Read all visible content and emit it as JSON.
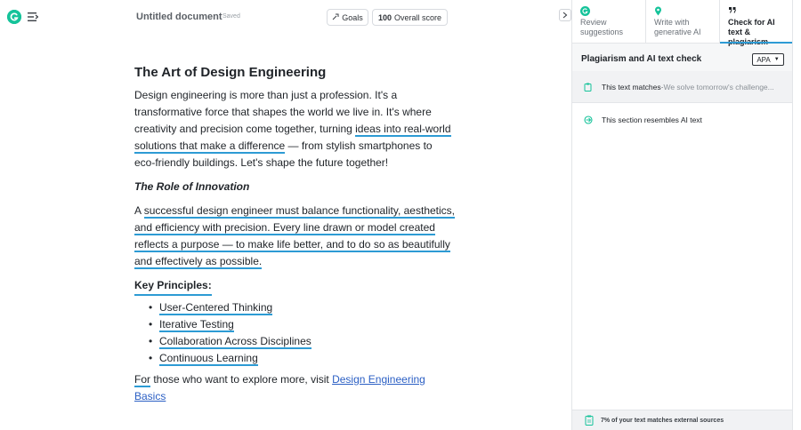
{
  "app": {
    "doc_title": "Untitled document",
    "save_status": "Saved",
    "goals_label": "Goals",
    "score_value": "100",
    "score_label": "Overall score",
    "accent_color": "#15c39a",
    "underline_color": "#2d9bd4"
  },
  "document": {
    "title": "The Art of Design Engineering",
    "intro_before": "Design engineering is more than just a profession. It's a transformative force that shapes the world we live in. It's where creativity and precision come together, turning ",
    "intro_highlight": "ideas into real-world solutions that make a difference",
    "intro_after": " — from stylish smartphones to eco-friendly buildings. Let's shape the future together!",
    "subtitle": "The Role of Innovation",
    "innovation_a": "A ",
    "innovation_highlight": "successful design engineer must balance functionality, aesthetics, and efficiency with precision. Every line drawn or model created reflects a purpose — to make life better, and to do so as beautifully and effectively as possible.",
    "principles_title": "Key Principles:",
    "principles": [
      "User-Centered Thinking",
      "Iterative Testing",
      "Collaboration Across Disciplines",
      "Continuous Learning"
    ],
    "closing_for": "For",
    "closing_text": " those who want to explore more, visit ",
    "closing_link": "Design Engineering Basics"
  },
  "panel": {
    "tabs": [
      {
        "label": "Review suggestions",
        "icon": "grammarly-icon",
        "active": false
      },
      {
        "label": "Write with generative AI",
        "icon": "location-pin-icon",
        "active": false
      },
      {
        "label": "Check for AI text & plagiarism",
        "icon": "quote-icon",
        "active": true
      }
    ],
    "section_title": "Plagiarism and AI text check",
    "citation_style": "APA",
    "match_label": "This text matches",
    "match_separator": " · ",
    "match_preview": "We solve tomorrow's challenge...",
    "ai_label": "This section resembles AI text",
    "footer_text": "7% of your text matches external sources"
  }
}
